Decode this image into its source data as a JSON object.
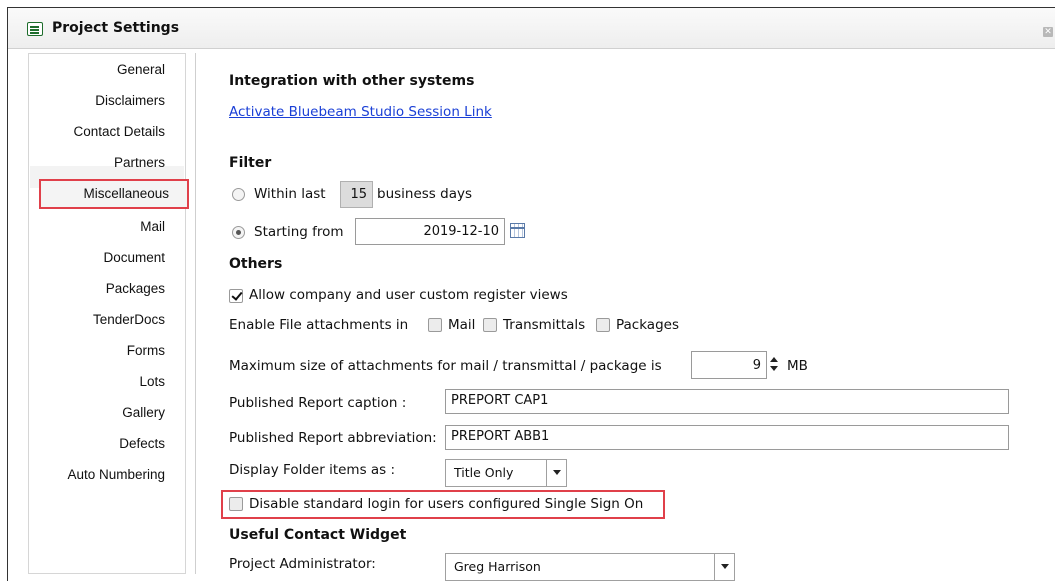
{
  "window": {
    "title": "Project Settings",
    "close_label": "✕"
  },
  "nav": {
    "items": [
      {
        "label": "General"
      },
      {
        "label": "Disclaimers"
      },
      {
        "label": "Contact Details"
      },
      {
        "label": "Partners"
      },
      {
        "label": "Miscellaneous"
      },
      {
        "label": "Mail"
      },
      {
        "label": "Document"
      },
      {
        "label": "Packages"
      },
      {
        "label": "TenderDocs"
      },
      {
        "label": "Forms"
      },
      {
        "label": "Lots"
      },
      {
        "label": "Gallery"
      },
      {
        "label": "Defects"
      },
      {
        "label": "Auto Numbering"
      }
    ],
    "selected": "Miscellaneous"
  },
  "integration": {
    "heading": "Integration with other systems",
    "link": "Activate Bluebeam Studio Session Link"
  },
  "filter": {
    "heading": "Filter",
    "within_label": "Within last",
    "within_value": "15",
    "within_suffix": "business days",
    "starting_label": "Starting from",
    "starting_value": "2019-12-10",
    "selected_option": "Starting from"
  },
  "others": {
    "heading": "Others",
    "allow_views_label": "Allow company and user custom register views",
    "allow_views_checked": true,
    "enable_attachments_label": "Enable File attachments in",
    "attach_mail_label": "Mail",
    "attach_transmittals_label": "Transmittals",
    "attach_packages_label": "Packages",
    "max_size_label": "Maximum size of attachments for mail / transmittal / package is",
    "max_size_value": "9",
    "max_size_unit": "MB",
    "report_caption_label": "Published Report caption :",
    "report_caption_value": "PREPORT CAP1",
    "report_abbrev_label": "Published Report abbreviation:",
    "report_abbrev_value": "PREPORT ABB1",
    "display_folder_label": "Display Folder items as :",
    "display_folder_value": "Title Only",
    "disable_login_label": "Disable standard login for users configured Single Sign On",
    "disable_login_checked": false
  },
  "widget": {
    "heading": "Useful Contact Widget",
    "admin_label": "Project Administrator:",
    "admin_value": "Greg Harrison"
  },
  "colors": {
    "highlight": "#e0404a",
    "link": "#1a3fd6"
  }
}
